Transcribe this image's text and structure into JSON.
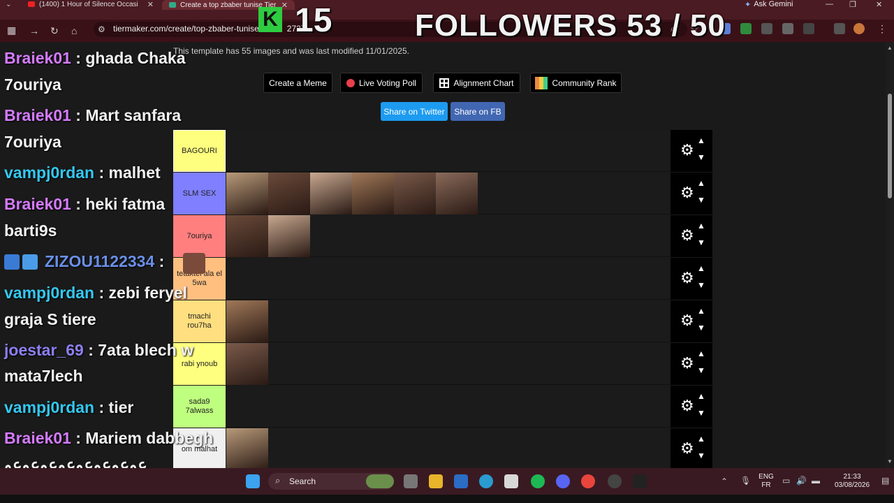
{
  "browser": {
    "tab1_title": "(1400) 1 Hour of Silence Occasi",
    "tab2_title": "Create a top zbaber tunise Tier",
    "ask_gemini": "Ask Gemini",
    "url": "tiermaker.com/create/top-zbaber-tunise",
    "url_tail": "2727"
  },
  "overlay": {
    "kick_count": "15",
    "followers": "FOLLOWERS 53 / 50"
  },
  "page": {
    "template_note": "This template has 55 images and was last modified 11/01/2025.",
    "buttons": {
      "create_meme": "Create a Meme",
      "live_voting": "Live Voting Poll",
      "alignment": "Alignment Chart",
      "community": "Community Rank",
      "share_twitter": "Share on Twitter",
      "share_fb": "Share on FB"
    },
    "tiers": [
      {
        "label": "BAGOURI",
        "color": "#ffff7f",
        "items": 0
      },
      {
        "label": "SLM SEX",
        "color": "#7f7fff",
        "items": 6
      },
      {
        "label": "7ouriya",
        "color": "#ff7f7f",
        "items": 2
      },
      {
        "label": "tetaktel ala el 5wa",
        "color": "#ffbf7f",
        "items": 0
      },
      {
        "label": "tmachi rou7ha",
        "color": "#ffdf7f",
        "items": 1
      },
      {
        "label": "rabi ynoub",
        "color": "#ffff7f",
        "items": 1
      },
      {
        "label": "sada9 7alwass",
        "color": "#bfff7f",
        "items": 0
      },
      {
        "label": "om malhat",
        "color": "#f0f0f0",
        "items": 1
      }
    ]
  },
  "chat": [
    {
      "user": "Braiek01",
      "color": "#d57bff",
      "msg": " : ghada Chaka"
    },
    {
      "user": "",
      "color": "#f2f2f2",
      "msg": "7ouriya"
    },
    {
      "user": "Braiek01",
      "color": "#d57bff",
      "msg": " : Mart sanfara"
    },
    {
      "user": "",
      "color": "#f2f2f2",
      "msg": "7ouriya"
    },
    {
      "user": "vampj0rdan",
      "color": "#34c8f0",
      "msg": " : malhet"
    },
    {
      "user": "Braiek01",
      "color": "#d57bff",
      "msg": " : heki fatma"
    },
    {
      "user": "",
      "color": "#f2f2f2",
      "msg": "barti9s"
    },
    {
      "user": "ZIZOU1122334",
      "color": "#6a8fe8",
      "msg": " :"
    },
    {
      "user": "vampj0rdan",
      "color": "#34c8f0",
      "msg": " : zebi feryel"
    },
    {
      "user": "",
      "color": "#f2f2f2",
      "msg": "graja S tiere"
    },
    {
      "user": "joestar_69",
      "color": "#8c7ff0",
      "msg": " : 7ata blech w"
    },
    {
      "user": "",
      "color": "#f2f2f2",
      "msg": "mata7lech"
    },
    {
      "user": "vampj0rdan",
      "color": "#34c8f0",
      "msg": " : tier"
    },
    {
      "user": "Braiek01",
      "color": "#d57bff",
      "msg": " : Mariem dabbegh"
    },
    {
      "user": "",
      "color": "#f2f2f2",
      "msg": "عوعوعوعوعوعوعوعو"
    }
  ],
  "taskbar": {
    "search": "Search",
    "lang1": "ENG",
    "lang2": "FR",
    "time": "21:33",
    "date": "03/08/2026"
  }
}
